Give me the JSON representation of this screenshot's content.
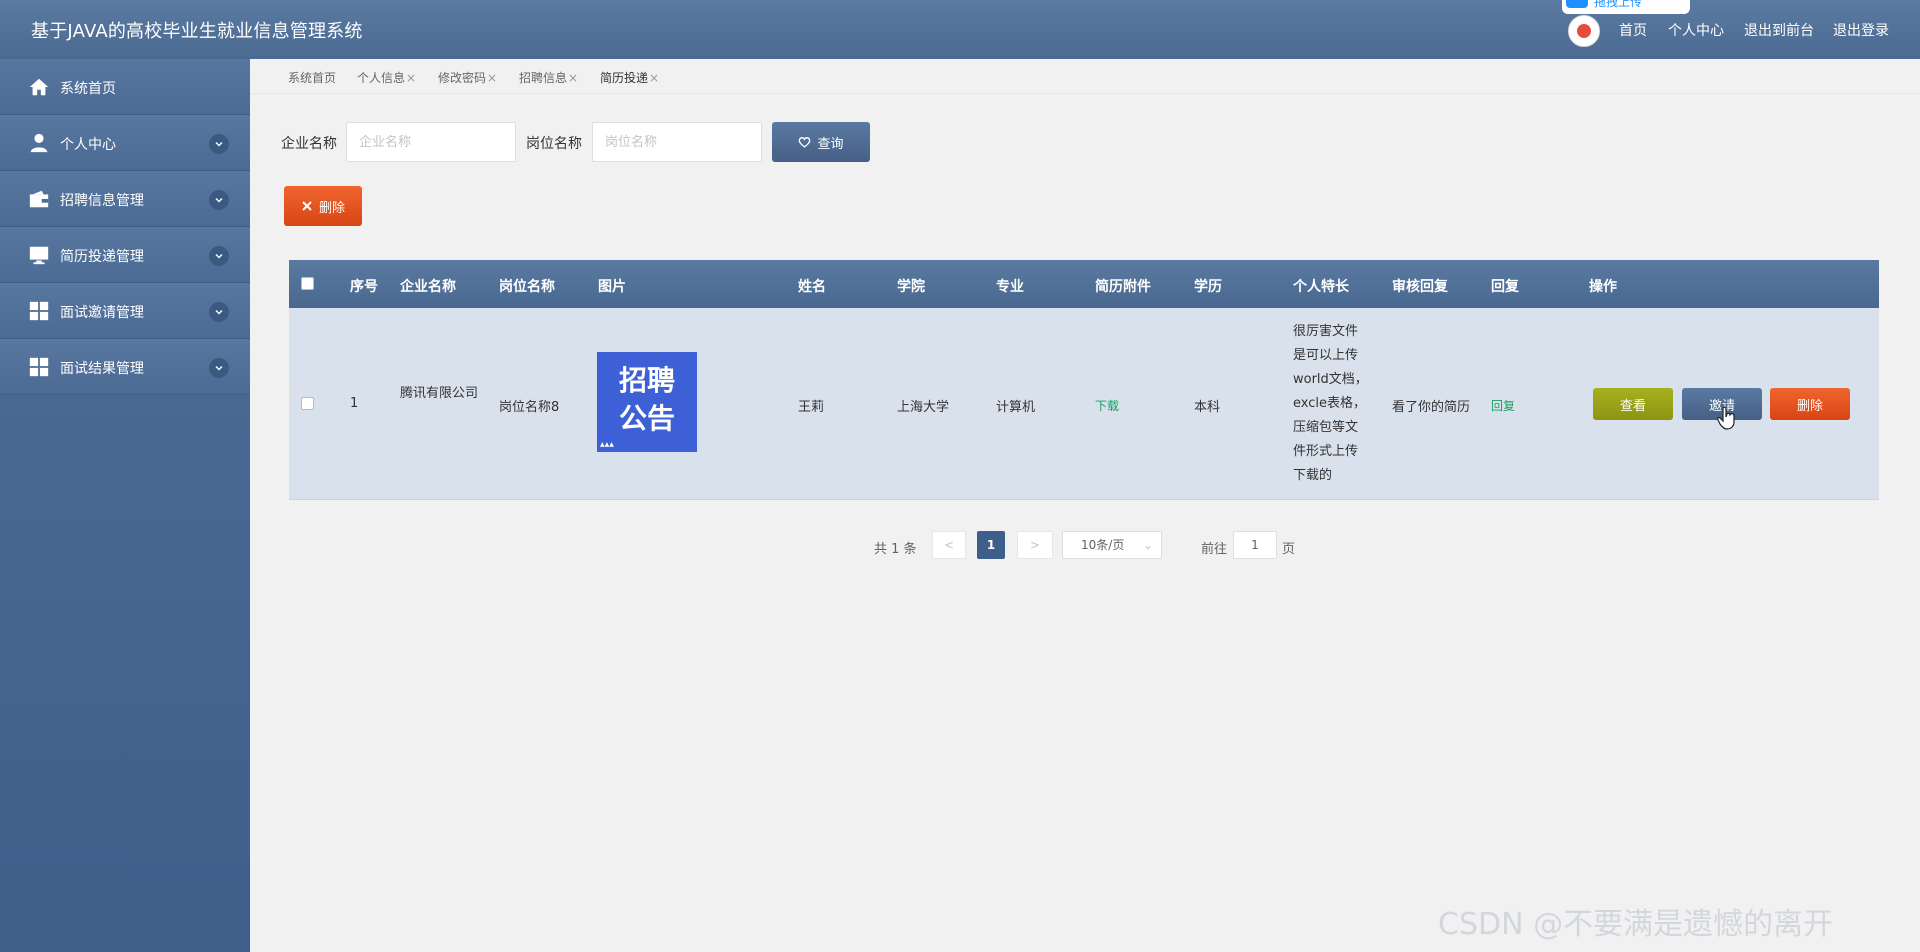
{
  "header": {
    "title": "基于JAVA的高校毕业生就业信息管理系统",
    "upload_badge": "拖拽上传",
    "nav": [
      "首页",
      "个人中心",
      "退出到前台",
      "退出登录"
    ]
  },
  "sidebar": {
    "items": [
      {
        "label": "系统首页",
        "icon": "home-icon",
        "has_chevron": false
      },
      {
        "label": "个人中心",
        "icon": "user-icon",
        "has_chevron": true
      },
      {
        "label": "招聘信息管理",
        "icon": "wallet-icon",
        "has_chevron": true
      },
      {
        "label": "简历投递管理",
        "icon": "monitor-icon",
        "has_chevron": true
      },
      {
        "label": "面试邀请管理",
        "icon": "grid-icon",
        "has_chevron": true
      },
      {
        "label": "面试结果管理",
        "icon": "grid-icon",
        "has_chevron": true
      }
    ]
  },
  "tabs": [
    "系统首页",
    "个人信息",
    "修改密码",
    "招聘信息",
    "简历投递"
  ],
  "search": {
    "company_label": "企业名称",
    "company_placeholder": "企业名称",
    "position_label": "岗位名称",
    "position_placeholder": "岗位名称",
    "query_button": "查询",
    "delete_button": "删除"
  },
  "table": {
    "headers": [
      "序号",
      "企业名称",
      "岗位名称",
      "图片",
      "姓名",
      "学院",
      "专业",
      "简历附件",
      "学历",
      "个人特长",
      "审核回复",
      "回复",
      "操作"
    ],
    "rows": [
      {
        "index": "1",
        "company": "腾讯有限公司",
        "position": "岗位名称8",
        "image_text_1": "招聘",
        "image_text_2": "公告",
        "name": "王莉",
        "college": "上海大学",
        "major": "计算机",
        "attachment": "下载",
        "education": "本科",
        "specialty": "很厉害文件是可以上传world文档，excle表格，压缩包等文件形式上传下载的",
        "review_reply": "看了你的简历",
        "reply": "回复",
        "ops": {
          "view": "查看",
          "invite": "邀请",
          "delete": "删除"
        }
      }
    ]
  },
  "pagination": {
    "total": "共 1 条",
    "prev": "<",
    "current_page": "1",
    "next": ">",
    "page_size": "10条/页",
    "goto_label": "前往",
    "goto_value": "1",
    "goto_suffix": "页"
  },
  "watermark": "CSDN @不要满是遗憾的离开",
  "colors": {
    "header": "#5b7aa1",
    "sidebar": "#4b6b94",
    "danger": "#e0541f",
    "olive": "#a6b01d",
    "green_link": "#19a15f"
  }
}
